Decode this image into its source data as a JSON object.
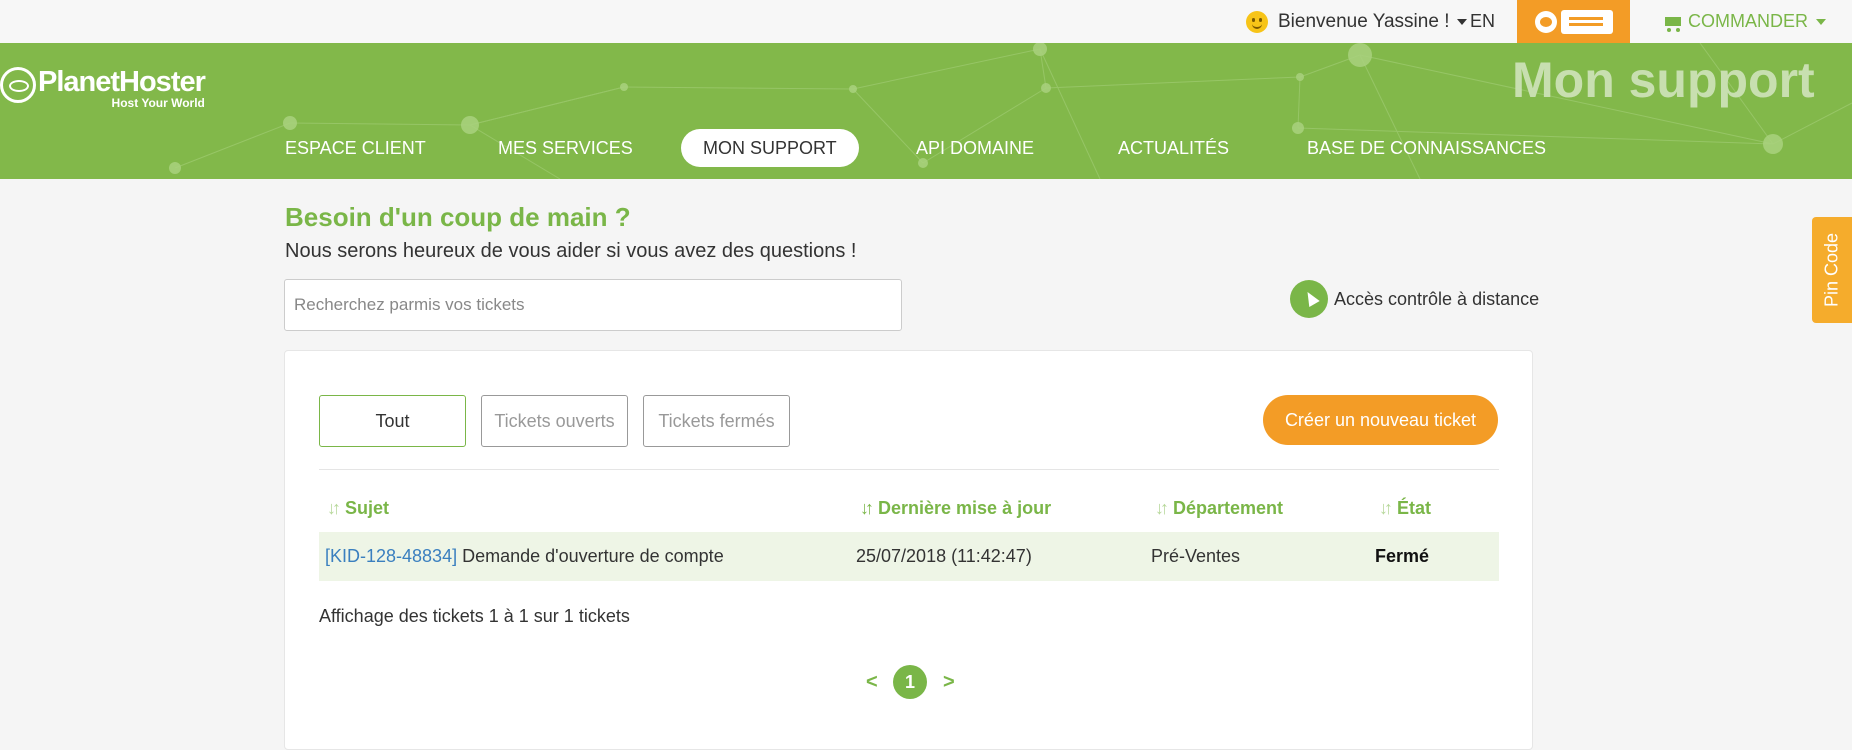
{
  "topbar": {
    "welcome": "Bienvenue Yassine !",
    "language": "EN",
    "commander": "COMMANDER"
  },
  "brand": {
    "name": "PlanetHoster",
    "tagline": "Host Your World"
  },
  "header": {
    "page_title": "Mon support"
  },
  "nav": {
    "items": [
      {
        "label": "ESPACE CLIENT"
      },
      {
        "label": "MES SERVICES"
      },
      {
        "label": "MON SUPPORT"
      },
      {
        "label": "API DOMAINE"
      },
      {
        "label": "ACTUALITÉS"
      },
      {
        "label": "BASE DE CONNAISSANCES"
      }
    ],
    "active": "MON SUPPORT"
  },
  "help": {
    "title": "Besoin d'un coup de main ?",
    "subtitle": "Nous serons heureux de vous aider si vous avez des questions !",
    "search_placeholder": "Recherchez parmis vos tickets",
    "remote_access": "Accès contrôle à distance"
  },
  "pin_code": "Pin Code",
  "tickets": {
    "filters": [
      {
        "label": "Tout"
      },
      {
        "label": "Tickets ouverts"
      },
      {
        "label": "Tickets fermés"
      }
    ],
    "active_filter": "Tout",
    "create_button": "Créer un nouveau ticket",
    "columns": [
      "Sujet",
      "Dernière mise à jour",
      "Département",
      "État"
    ],
    "rows": [
      {
        "id": "[KID-128-48834]",
        "subject": "Demande d'ouverture de compte",
        "updated": "25/07/2018 (11:42:47)",
        "department": "Pré-Ventes",
        "status": "Fermé"
      }
    ],
    "summary": "Affichage des tickets 1 à 1 sur 1 tickets",
    "pagination": {
      "prev": "<",
      "current": "1",
      "next": ">"
    }
  },
  "colors": {
    "brand_green": "#82b84a",
    "accent_orange": "#f39c26",
    "link_blue": "#3a7fbf"
  }
}
